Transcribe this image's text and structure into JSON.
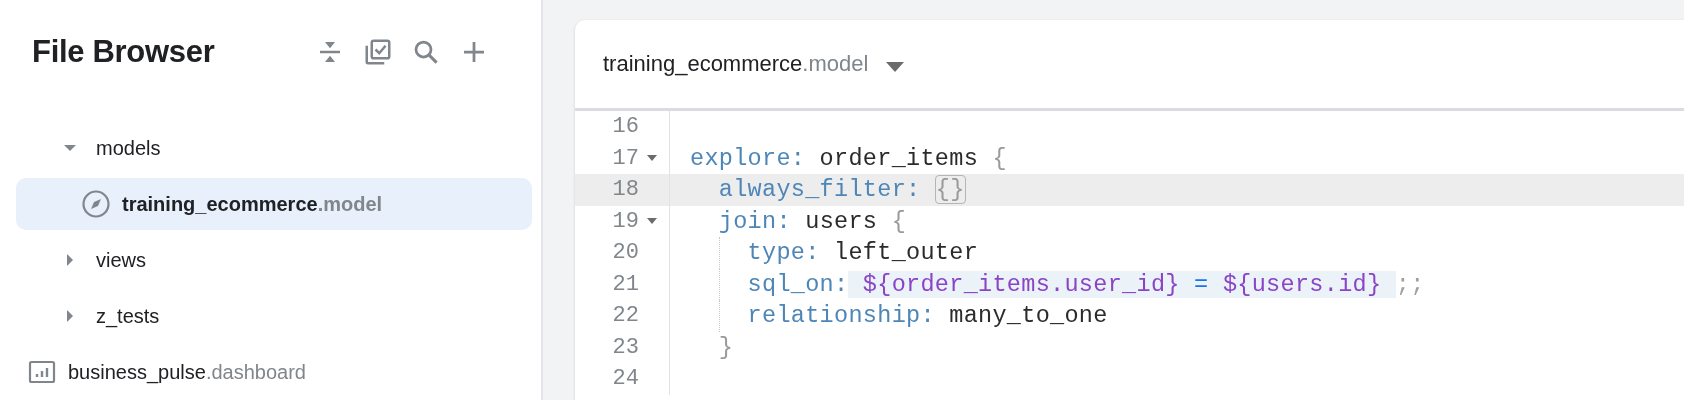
{
  "sidebar": {
    "title": "File Browser",
    "tools": [
      {
        "kind": "collapse"
      },
      {
        "kind": "validate"
      },
      {
        "kind": "search"
      },
      {
        "kind": "add"
      }
    ],
    "tree": [
      {
        "kind": "folder",
        "name": "models",
        "expanded": true,
        "selected": false,
        "children": [
          {
            "kind": "model",
            "name": "training_ecommerce",
            "ext": ".model",
            "selected": true
          }
        ]
      },
      {
        "kind": "folder",
        "name": "views",
        "expanded": false,
        "selected": false
      },
      {
        "kind": "folder",
        "name": "z_tests",
        "expanded": false,
        "selected": false
      },
      {
        "kind": "dashboard",
        "name": "business_pulse",
        "ext": ".dashboard",
        "selected": false
      }
    ]
  },
  "editor": {
    "file": {
      "name": "training_ecommerce",
      "ext": ".model"
    },
    "lines": [
      {
        "number": "16",
        "fold": false,
        "active": false,
        "guide": false
      },
      {
        "number": "17",
        "fold": true,
        "active": false,
        "guide": false,
        "tokens": [
          {
            "text": "explore:",
            "kind": "key"
          },
          {
            "text": " order_items",
            "kind": "plain"
          },
          {
            "text": " {",
            "kind": "brace"
          }
        ]
      },
      {
        "number": "18",
        "fold": false,
        "active": true,
        "guide": false,
        "tokens": [
          {
            "text": "  always_filter: ",
            "kind": "key"
          },
          {
            "text": "{}",
            "kind": "matched"
          }
        ]
      },
      {
        "number": "19",
        "fold": true,
        "active": false,
        "guide": false,
        "tokens": [
          {
            "text": "  join:",
            "kind": "key"
          },
          {
            "text": " users",
            "kind": "plain"
          },
          {
            "text": " {",
            "kind": "brace"
          }
        ]
      },
      {
        "number": "20",
        "fold": false,
        "active": false,
        "guide": true,
        "tokens": [
          {
            "text": "    type:",
            "kind": "key"
          },
          {
            "text": " left_outer",
            "kind": "plain"
          }
        ]
      },
      {
        "number": "21",
        "fold": false,
        "active": false,
        "guide": true,
        "tokens": [
          {
            "text": "    sql_on:",
            "kind": "key"
          },
          {
            "highlight": true,
            "tokens": [
              {
                "text": " ${order_items.user_id}",
                "kind": "var"
              },
              {
                "text": " =",
                "kind": "op"
              },
              {
                "text": " ${users.id} ",
                "kind": "var"
              }
            ]
          },
          {
            "text": ";;",
            "kind": "punct"
          }
        ]
      },
      {
        "number": "22",
        "fold": false,
        "active": false,
        "guide": true,
        "tokens": [
          {
            "text": "    relationship:",
            "kind": "key"
          },
          {
            "text": " many_to_one",
            "kind": "plain"
          }
        ]
      },
      {
        "number": "23",
        "fold": false,
        "active": false,
        "guide": false,
        "tokens": [
          {
            "text": "  }",
            "kind": "brace"
          }
        ]
      },
      {
        "number": "24",
        "fold": false,
        "active": false,
        "guide": false
      }
    ]
  }
}
